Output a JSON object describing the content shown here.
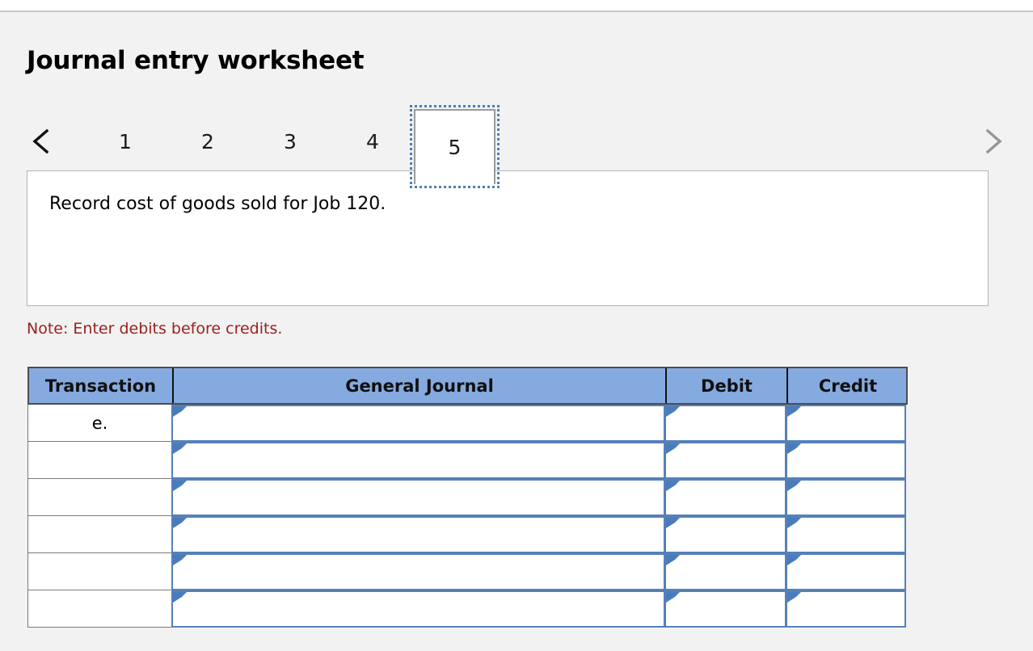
{
  "page": {
    "title": "Journal entry worksheet",
    "background_color": "#f2f2f2"
  },
  "pager": {
    "prev_icon": "chevron-left-icon",
    "next_icon": "chevron-right-icon",
    "prev_color": "#111111",
    "next_color": "#969696",
    "tabs": [
      {
        "label": "1",
        "active": false
      },
      {
        "label": "2",
        "active": false
      },
      {
        "label": "3",
        "active": false
      },
      {
        "label": "4",
        "active": false
      },
      {
        "label": "5",
        "active": true
      }
    ],
    "active_tab": "5",
    "focus_ring_color": "#4a7ebb"
  },
  "description": {
    "text": "Record cost of goods sold for Job 120."
  },
  "note": {
    "text": "Note: Enter debits before credits.",
    "color": "#9c2020"
  },
  "journal_table": {
    "header_background": "#85aae0",
    "input_border_color": "#5581b7",
    "columns": [
      {
        "key": "transaction",
        "label": "Transaction"
      },
      {
        "key": "general_journal",
        "label": "General Journal"
      },
      {
        "key": "debit",
        "label": "Debit"
      },
      {
        "key": "credit",
        "label": "Credit"
      }
    ],
    "rows": [
      {
        "transaction": "e.",
        "general_journal": "",
        "debit": "",
        "credit": ""
      },
      {
        "transaction": "",
        "general_journal": "",
        "debit": "",
        "credit": ""
      },
      {
        "transaction": "",
        "general_journal": "",
        "debit": "",
        "credit": ""
      },
      {
        "transaction": "",
        "general_journal": "",
        "debit": "",
        "credit": ""
      },
      {
        "transaction": "",
        "general_journal": "",
        "debit": "",
        "credit": ""
      },
      {
        "transaction": "",
        "general_journal": "",
        "debit": "",
        "credit": ""
      }
    ]
  }
}
